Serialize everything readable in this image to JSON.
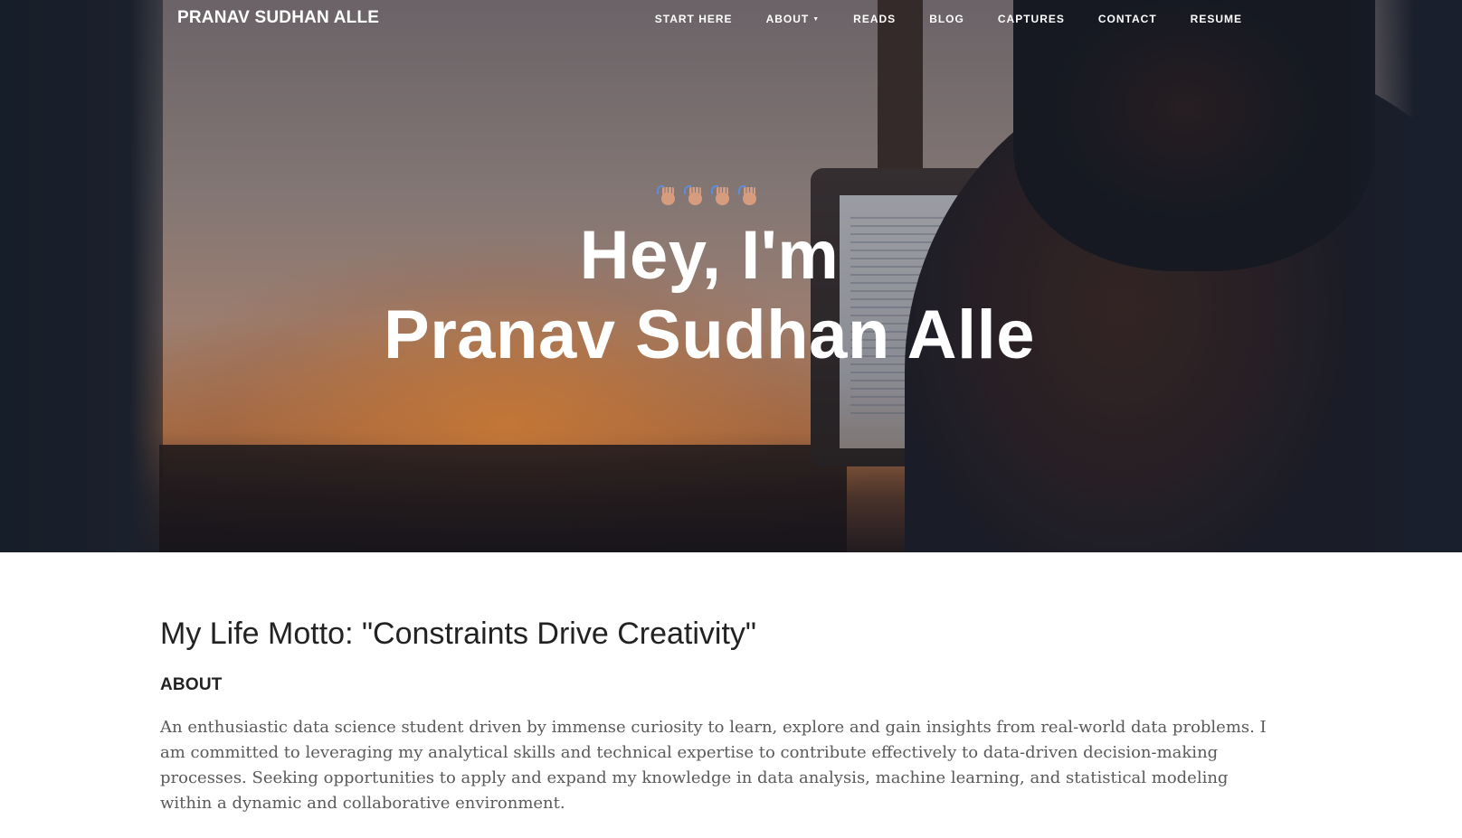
{
  "nav": {
    "brand": "PRANAV SUDHAN ALLE",
    "links": [
      {
        "label": "START HERE"
      },
      {
        "label": "ABOUT",
        "caret": "▼"
      },
      {
        "label": "READS"
      },
      {
        "label": "BLOG"
      },
      {
        "label": "CAPTURES"
      },
      {
        "label": "CONTACT"
      },
      {
        "label": "RESUME"
      }
    ]
  },
  "hero": {
    "emoji": "wave-icon",
    "emoji_count": 4,
    "title_line1": "Hey, I'm",
    "title_line2": "Pranav Sudhan Alle"
  },
  "main": {
    "motto": "My Life Motto: \"Constraints Drive Creativity\"",
    "about_heading": "ABOUT",
    "about_text": "An enthusiastic data science student driven by immense curiosity to learn, explore and gain insights from real-world data problems. I am committed to leveraging my analytical skills and technical expertise to contribute effectively to data-driven decision-making processes. Seeking opportunities to apply and expand my knowledge in data analysis, machine learning, and statistical modeling within a dynamic and collaborative environment."
  },
  "colors": {
    "text_dark": "#222222",
    "text_body": "#5a5a5a",
    "nav_text": "#ffffff"
  }
}
